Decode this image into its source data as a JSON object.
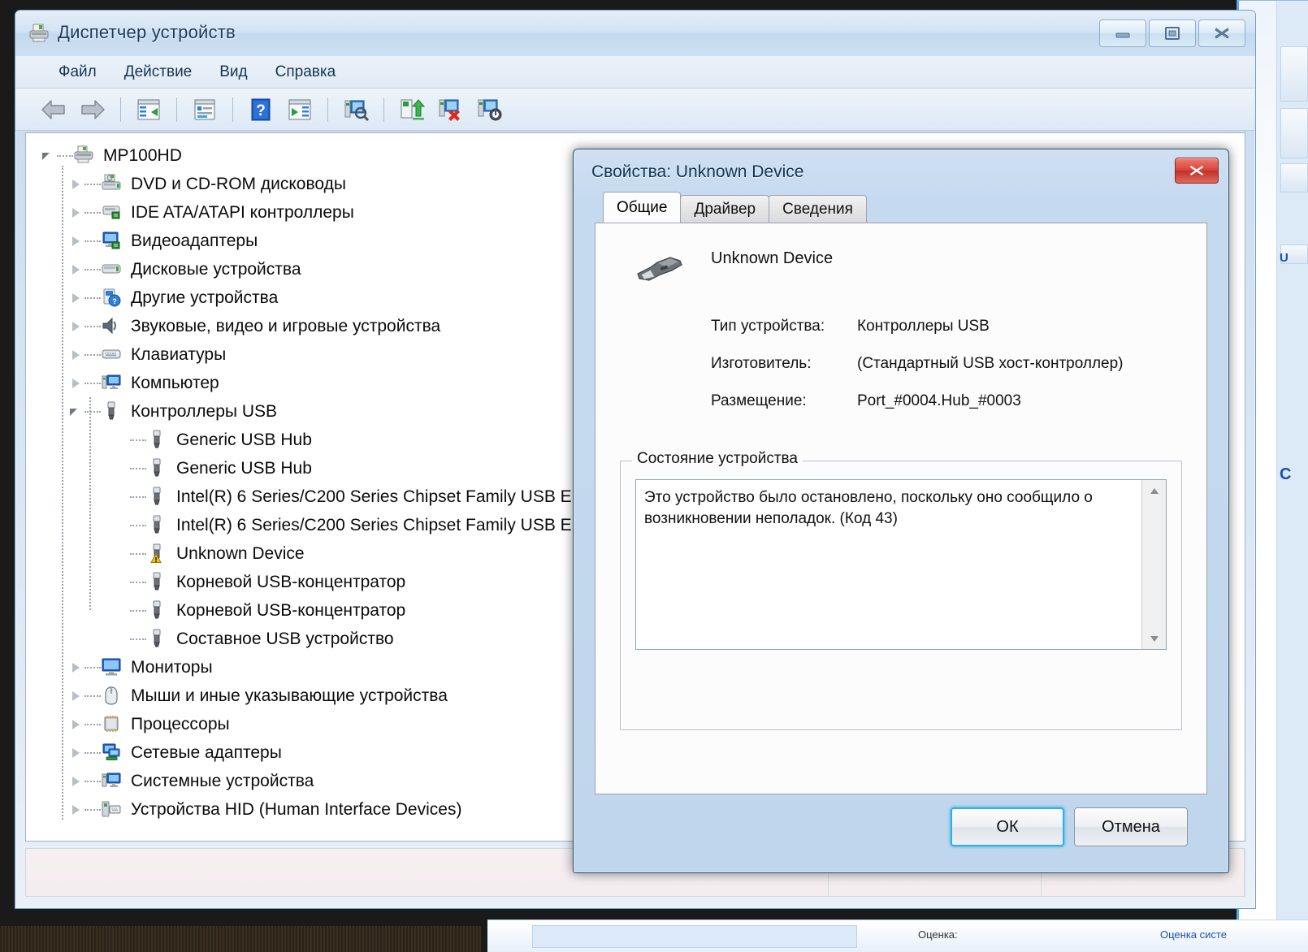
{
  "window": {
    "title": "Диспетчер устройств",
    "icon": "device-manager-icon",
    "controls": {
      "minimize": "minimize-icon",
      "maximize": "restore-icon",
      "close": "close-icon"
    }
  },
  "menu": {
    "items": [
      {
        "label": "Файл",
        "name": "menu-file"
      },
      {
        "label": "Действие",
        "name": "menu-action"
      },
      {
        "label": "Вид",
        "name": "menu-view"
      },
      {
        "label": "Справка",
        "name": "menu-help"
      }
    ]
  },
  "toolbar": {
    "buttons": [
      {
        "name": "back-icon",
        "title": "Назад"
      },
      {
        "name": "forward-icon",
        "title": "Вперед"
      },
      {
        "name": "show-hide-console-tree-icon",
        "title": "Отобразить/скрыть дерево консоли"
      },
      {
        "name": "properties-icon",
        "title": "Свойства"
      },
      {
        "name": "help-icon",
        "title": "Справка"
      },
      {
        "name": "show-hide-action-pane-icon",
        "title": "Панель действий"
      },
      {
        "name": "scan-hardware-changes-icon",
        "title": "Обновить конфигурацию оборудования"
      },
      {
        "name": "update-driver-icon",
        "title": "Обновить драйверы"
      },
      {
        "name": "uninstall-device-icon",
        "title": "Удалить устройство"
      },
      {
        "name": "disable-device-icon",
        "title": "Отключить устройство"
      }
    ]
  },
  "tree": {
    "root": {
      "label": "MP100HD",
      "icon": "computer-root-icon",
      "expanded": true
    },
    "nodes": [
      {
        "label": "DVD и CD-ROM дисководы",
        "icon": "dvd-drive-icon",
        "level": 1,
        "state": "collapsed"
      },
      {
        "label": "IDE ATA/ATAPI контроллеры",
        "icon": "ide-controller-icon",
        "level": 1,
        "state": "collapsed"
      },
      {
        "label": "Видеоадаптеры",
        "icon": "display-adapter-icon",
        "level": 1,
        "state": "collapsed"
      },
      {
        "label": "Дисковые устройства",
        "icon": "disk-drive-icon",
        "level": 1,
        "state": "collapsed"
      },
      {
        "label": "Другие устройства",
        "icon": "other-devices-icon",
        "level": 1,
        "state": "collapsed"
      },
      {
        "label": "Звуковые, видео и игровые устройства",
        "icon": "sound-device-icon",
        "level": 1,
        "state": "collapsed"
      },
      {
        "label": "Клавиатуры",
        "icon": "keyboard-icon",
        "level": 1,
        "state": "collapsed"
      },
      {
        "label": "Компьютер",
        "icon": "computer-icon",
        "level": 1,
        "state": "collapsed"
      },
      {
        "label": "Контроллеры USB",
        "icon": "usb-controller-icon",
        "level": 1,
        "state": "expanded"
      },
      {
        "label": "Generic USB Hub",
        "icon": "usb-device-icon",
        "level": 2,
        "state": "leaf"
      },
      {
        "label": "Generic USB Hub",
        "icon": "usb-device-icon",
        "level": 2,
        "state": "leaf"
      },
      {
        "label": "Intel(R) 6 Series/C200 Series Chipset Family USB E",
        "icon": "usb-device-icon",
        "level": 2,
        "state": "leaf"
      },
      {
        "label": "Intel(R) 6 Series/C200 Series Chipset Family USB E",
        "icon": "usb-device-icon",
        "level": 2,
        "state": "leaf"
      },
      {
        "label": "Unknown Device",
        "icon": "usb-device-warning-icon",
        "level": 2,
        "state": "leaf",
        "selected": false,
        "warning": true
      },
      {
        "label": "Корневой USB-концентратор",
        "icon": "usb-device-icon",
        "level": 2,
        "state": "leaf"
      },
      {
        "label": "Корневой USB-концентратор",
        "icon": "usb-device-icon",
        "level": 2,
        "state": "leaf"
      },
      {
        "label": "Составное USB устройство",
        "icon": "usb-device-icon",
        "level": 2,
        "state": "leaf"
      },
      {
        "label": "Мониторы",
        "icon": "monitor-icon",
        "level": 1,
        "state": "collapsed"
      },
      {
        "label": "Мыши и иные указывающие устройства",
        "icon": "mouse-icon",
        "level": 1,
        "state": "collapsed"
      },
      {
        "label": "Процессоры",
        "icon": "processor-icon",
        "level": 1,
        "state": "collapsed"
      },
      {
        "label": "Сетевые адаптеры",
        "icon": "network-adapter-icon",
        "level": 1,
        "state": "collapsed"
      },
      {
        "label": "Системные устройства",
        "icon": "system-device-icon",
        "level": 1,
        "state": "collapsed"
      },
      {
        "label": "Устройства HID (Human Interface Devices)",
        "icon": "hid-device-icon",
        "level": 1,
        "state": "collapsed"
      }
    ]
  },
  "dialog": {
    "title": "Свойства: Unknown Device",
    "close_icon": "close-icon",
    "tabs": [
      {
        "label": "Общие",
        "name": "tab-general",
        "active": true
      },
      {
        "label": "Драйвер",
        "name": "tab-driver",
        "active": false
      },
      {
        "label": "Сведения",
        "name": "tab-details",
        "active": false
      }
    ],
    "device": {
      "icon": "usb-connector-icon",
      "name": "Unknown Device",
      "properties": [
        {
          "label": "Тип устройства:",
          "value": "Контроллеры USB",
          "name": "device-type"
        },
        {
          "label": "Изготовитель:",
          "value": "(Стандартный USB хост-контроллер)",
          "name": "device-manufacturer"
        },
        {
          "label": "Размещение:",
          "value": "Port_#0004.Hub_#0003",
          "name": "device-location"
        }
      ]
    },
    "status_group": {
      "legend": "Состояние устройства",
      "text": "Это устройство было остановлено, поскольку оно сообщило о возникновении неполадок. (Код 43)"
    },
    "buttons": {
      "ok": "ОК",
      "cancel": "Отмена"
    }
  },
  "statusbar": {
    "main": "",
    "pane2": "",
    "pane3": ""
  },
  "background": {
    "labels": [
      "Оценка:",
      "Оценка систе"
    ]
  },
  "colors": {
    "accent": "#2fb0e8",
    "title_text": "#14344f",
    "close_red": "#d7453b",
    "warning_yellow": "#ffc20e",
    "tree_text": "#0b0b0b"
  }
}
